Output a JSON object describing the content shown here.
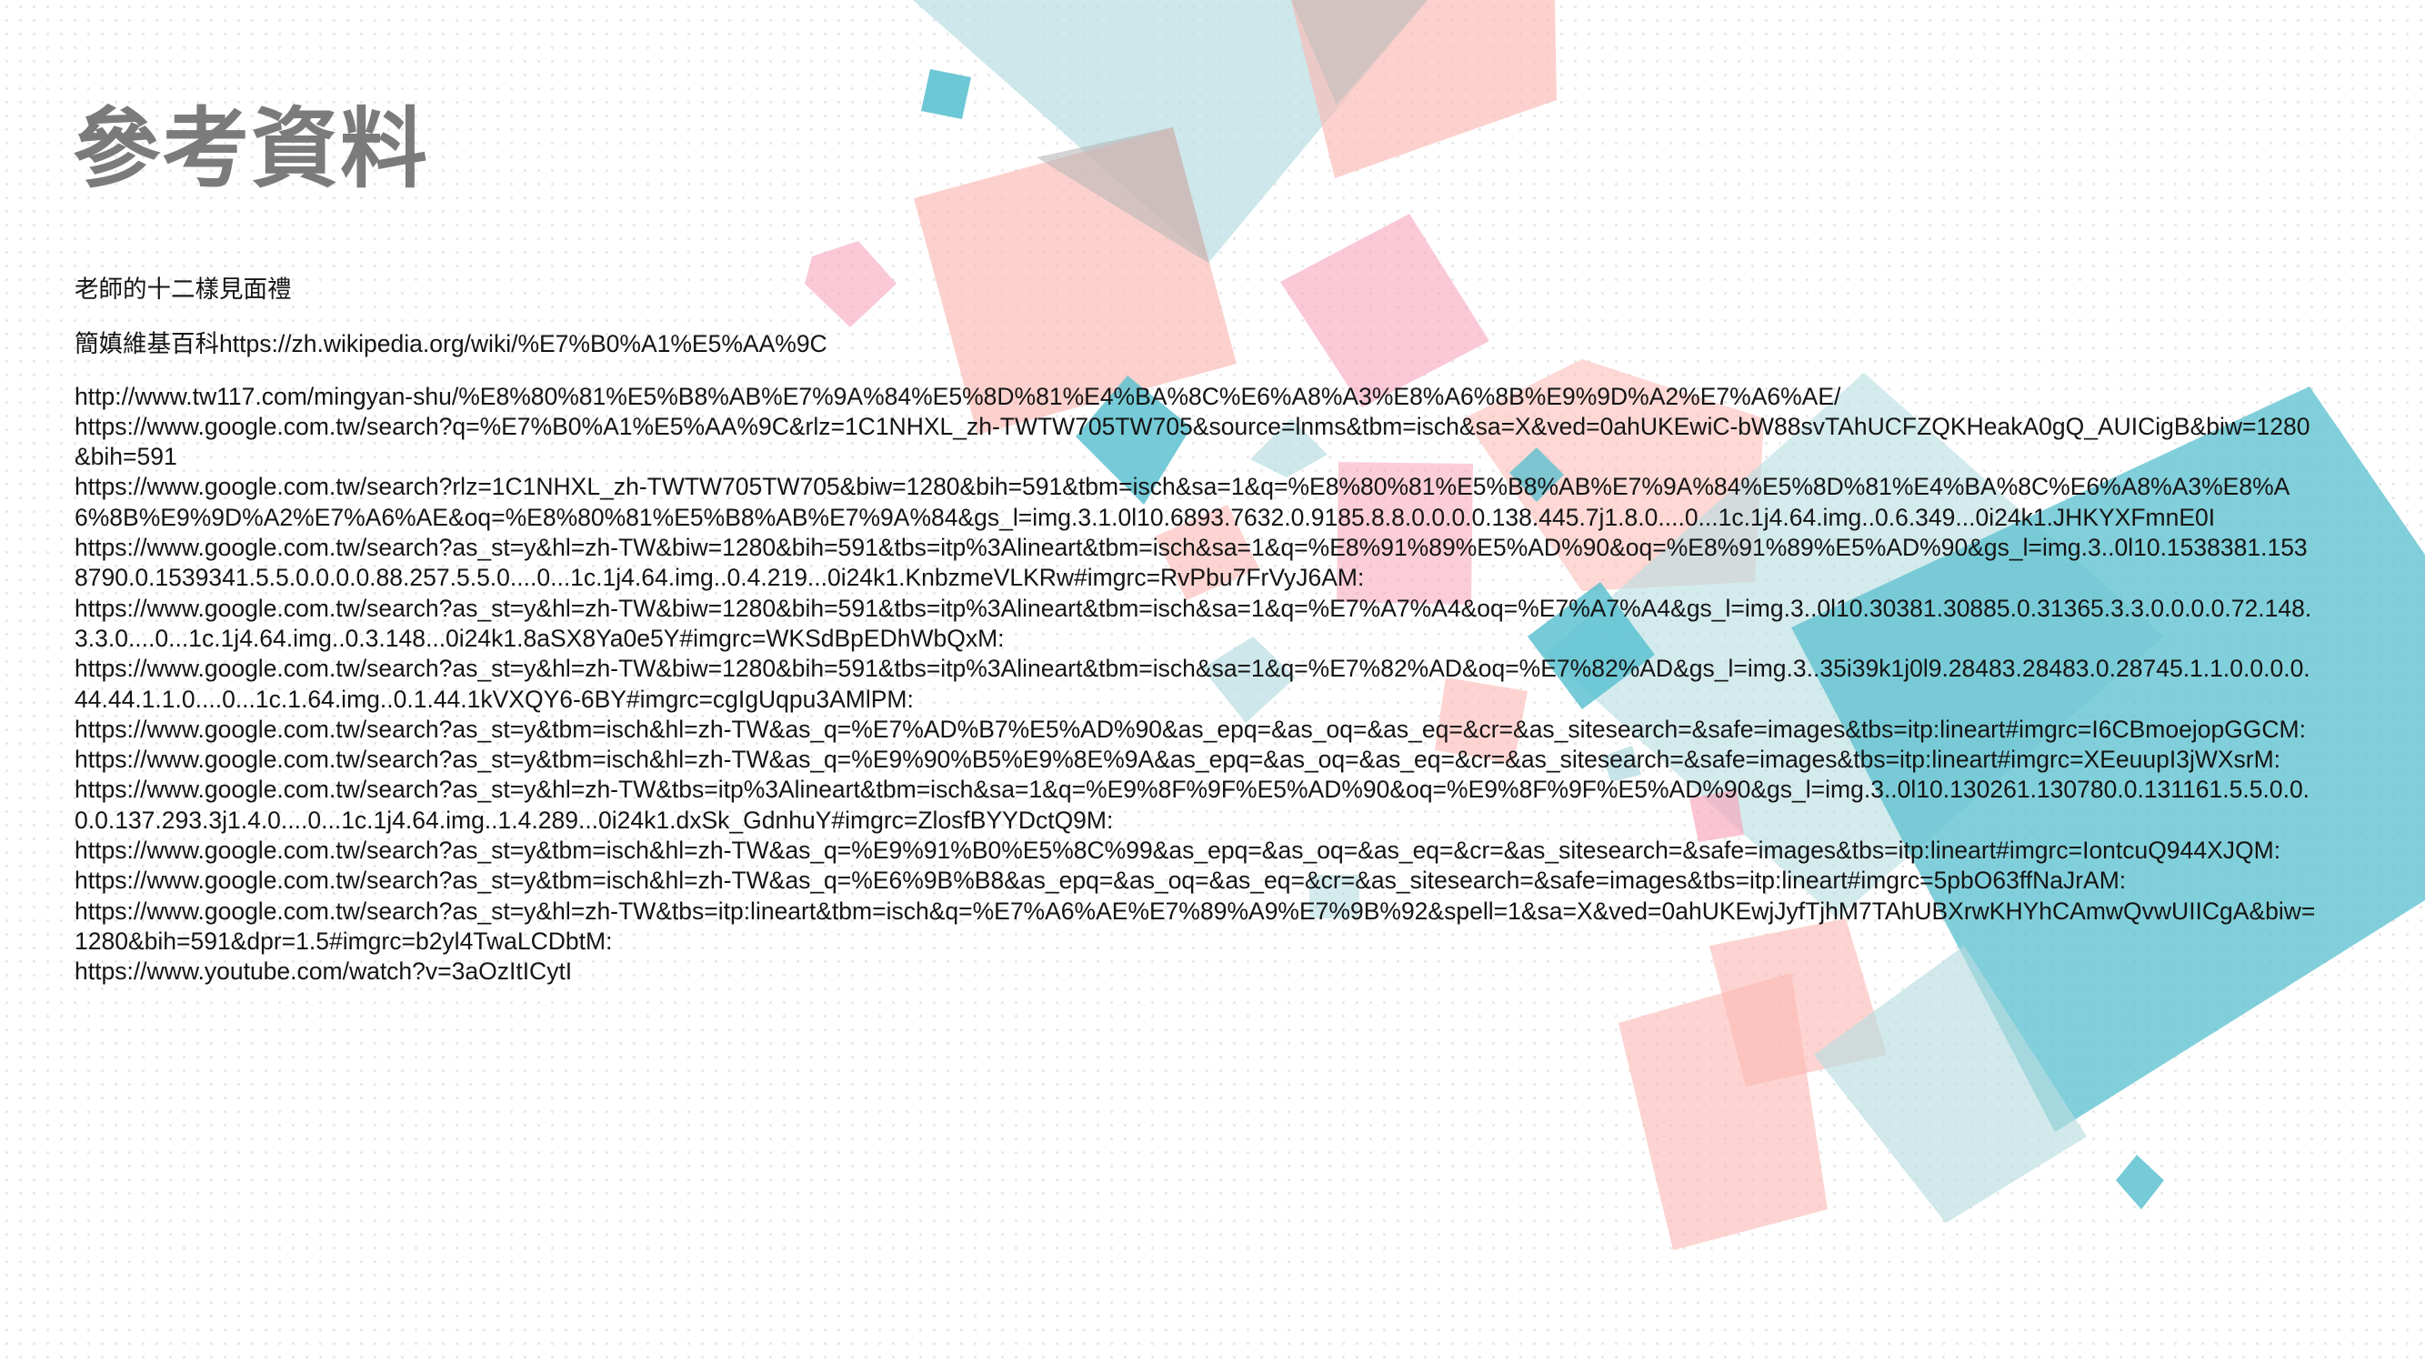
{
  "slide": {
    "title": "參考資料",
    "colors": {
      "teal": "#5dc2d0",
      "light_teal": "#b8dde1",
      "pink": "#fbb8b2",
      "rose": "#f7a4ba",
      "title_gray": "#7b7b7b"
    },
    "references": [
      "老師的十二樣見面禮",
      "簡嫃維基百科https://zh.wikipedia.org/wiki/%E7%B0%A1%E5%AA%9C",
      "http://www.tw117.com/mingyan-shu/%E8%80%81%E5%B8%AB%E7%9A%84%E5%8D%81%E4%BA%8C%E6%A8%A3%E8%A6%8B%E9%9D%A2%E7%A6%AE/",
      "https://www.google.com.tw/search?q=%E7%B0%A1%E5%AA%9C&rlz=1C1NHXL_zh-TWTW705TW705&source=lnms&tbm=isch&sa=X&ved=0ahUKEwiC-bW88svTAhUCFZQKHeakA0gQ_AUICigB&biw=1280&bih=591",
      "https://www.google.com.tw/search?rlz=1C1NHXL_zh-TWTW705TW705&biw=1280&bih=591&tbm=isch&sa=1&q=%E8%80%81%E5%B8%AB%E7%9A%84%E5%8D%81%E4%BA%8C%E6%A8%A3%E8%A6%8B%E9%9D%A2%E7%A6%AE&oq=%E8%80%81%E5%B8%AB%E7%9A%84&gs_l=img.3.1.0l10.6893.7632.0.9185.8.8.0.0.0.0.138.445.7j1.8.0....0...1c.1j4.64.img..0.6.349...0i24k1.JHKYXFmnE0I",
      "https://www.google.com.tw/search?as_st=y&hl=zh-TW&biw=1280&bih=591&tbs=itp%3Alineart&tbm=isch&sa=1&q=%E8%91%89%E5%AD%90&oq=%E8%91%89%E5%AD%90&gs_l=img.3..0l10.1538381.1538790.0.1539341.5.5.0.0.0.0.88.257.5.5.0....0...1c.1j4.64.img..0.4.219...0i24k1.KnbzmeVLKRw#imgrc=RvPbu7FrVyJ6AM:",
      "https://www.google.com.tw/search?as_st=y&hl=zh-TW&biw=1280&bih=591&tbs=itp%3Alineart&tbm=isch&sa=1&q=%E7%A7%A4&oq=%E7%A7%A4&gs_l=img.3..0l10.30381.30885.0.31365.3.3.0.0.0.0.72.148.3.3.0....0...1c.1j4.64.img..0.3.148...0i24k1.8aSX8Ya0e5Y#imgrc=WKSdBpEDhWbQxM:",
      "https://www.google.com.tw/search?as_st=y&hl=zh-TW&biw=1280&bih=591&tbs=itp%3Alineart&tbm=isch&sa=1&q=%E7%82%AD&oq=%E7%82%AD&gs_l=img.3..35i39k1j0l9.28483.28483.0.28745.1.1.0.0.0.0.44.44.1.1.0....0...1c.1.64.img..0.1.44.1kVXQY6-6BY#imgrc=cgIgUqpu3AMlPM:",
      "https://www.google.com.tw/search?as_st=y&tbm=isch&hl=zh-TW&as_q=%E7%AD%B7%E5%AD%90&as_epq=&as_oq=&as_eq=&cr=&as_sitesearch=&safe=images&tbs=itp:lineart#imgrc=I6CBmoejopGGCM:",
      "https://www.google.com.tw/search?as_st=y&tbm=isch&hl=zh-TW&as_q=%E9%90%B5%E9%8E%9A&as_epq=&as_oq=&as_eq=&cr=&as_sitesearch=&safe=images&tbs=itp:lineart#imgrc=XEeuupI3jWXsrM:",
      "https://www.google.com.tw/search?as_st=y&hl=zh-TW&tbs=itp%3Alineart&tbm=isch&sa=1&q=%E9%8F%9F%E5%AD%90&oq=%E9%8F%9F%E5%AD%90&gs_l=img.3..0l10.130261.130780.0.131161.5.5.0.0.0.0.137.293.3j1.4.0....0...1c.1j4.64.img..1.4.289...0i24k1.dxSk_GdnhuY#imgrc=ZlosfBYYDctQ9M:",
      "https://www.google.com.tw/search?as_st=y&tbm=isch&hl=zh-TW&as_q=%E9%91%B0%E5%8C%99&as_epq=&as_oq=&as_eq=&cr=&as_sitesearch=&safe=images&tbs=itp:lineart#imgrc=IontcuQ944XJQM:",
      "https://www.google.com.tw/search?as_st=y&tbm=isch&hl=zh-TW&as_q=%E6%9B%B8&as_epq=&as_oq=&as_eq=&cr=&as_sitesearch=&safe=images&tbs=itp:lineart#imgrc=5pbO63ffNaJrAM:",
      "https://www.google.com.tw/search?as_st=y&hl=zh-TW&tbs=itp:lineart&tbm=isch&q=%E7%A6%AE%E7%89%A9%E7%9B%92&spell=1&sa=X&ved=0ahUKEwjJyfTjhM7TAhUBXrwKHYhCAmwQvwUIICgA&biw=1280&bih=591&dpr=1.5#imgrc=b2yl4TwaLCDbtM:",
      "https://www.youtube.com/watch?v=3aOzItICytI"
    ]
  }
}
